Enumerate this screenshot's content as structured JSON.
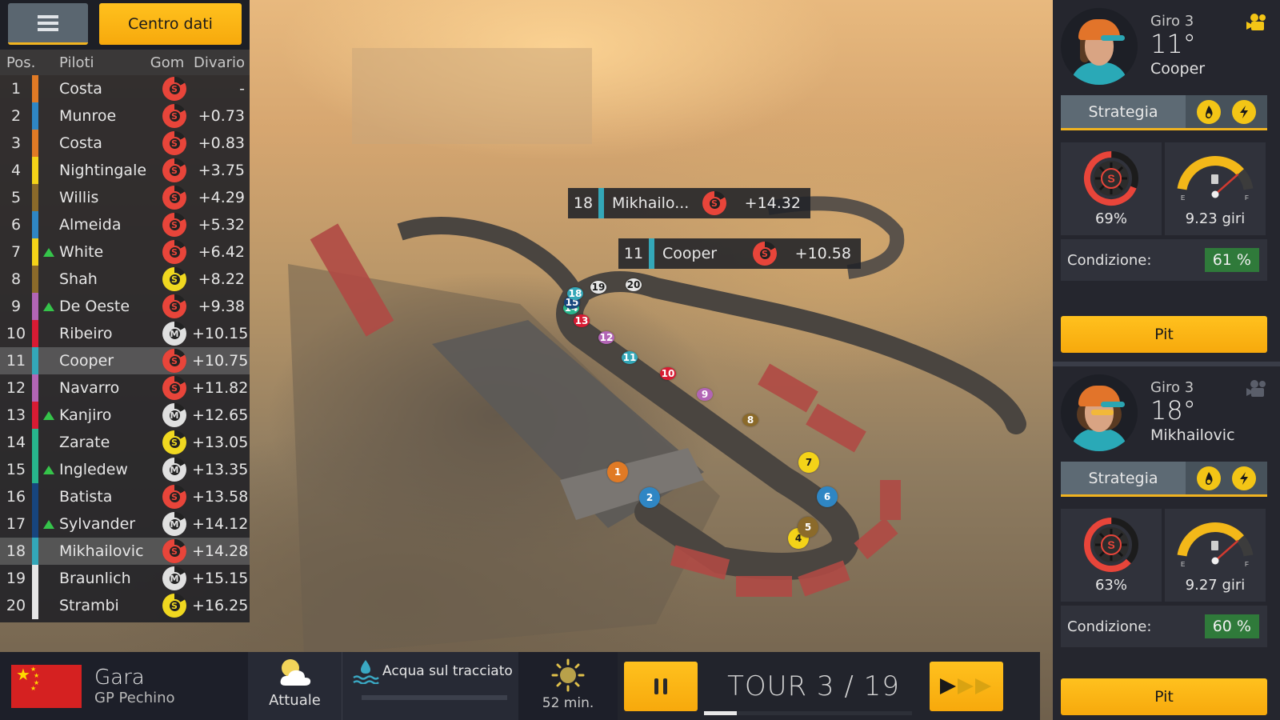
{
  "header": {
    "menu_icon": "hamburger-menu-icon",
    "data_center_label": "Centro dati"
  },
  "standings": {
    "columns": {
      "pos": "Pos.",
      "driver": "Piloti",
      "tyre": "Gom",
      "gap": "Divario"
    },
    "rows": [
      {
        "pos": "1",
        "name": "Costa",
        "team_color": "#e07a25",
        "tyre": "S",
        "tyre_color": "#e8453a",
        "gap": "-",
        "up": false,
        "highlight": false
      },
      {
        "pos": "2",
        "name": "Munroe",
        "team_color": "#2f86c4",
        "tyre": "S",
        "tyre_color": "#e8453a",
        "gap": "+0.73",
        "up": false,
        "highlight": false
      },
      {
        "pos": "3",
        "name": "Costa",
        "team_color": "#e07a25",
        "tyre": "S",
        "tyre_color": "#e8453a",
        "gap": "+0.83",
        "up": false,
        "highlight": false
      },
      {
        "pos": "4",
        "name": "Nightingale",
        "team_color": "#f4d318",
        "tyre": "S",
        "tyre_color": "#e8453a",
        "gap": "+3.75",
        "up": false,
        "highlight": false
      },
      {
        "pos": "5",
        "name": "Willis",
        "team_color": "#8b6a2a",
        "tyre": "S",
        "tyre_color": "#e8453a",
        "gap": "+4.29",
        "up": false,
        "highlight": false
      },
      {
        "pos": "6",
        "name": "Almeida",
        "team_color": "#2f86c4",
        "tyre": "S",
        "tyre_color": "#e8453a",
        "gap": "+5.32",
        "up": false,
        "highlight": false
      },
      {
        "pos": "7",
        "name": "White",
        "team_color": "#f4d318",
        "tyre": "S",
        "tyre_color": "#e8453a",
        "gap": "+6.42",
        "up": true,
        "highlight": false
      },
      {
        "pos": "8",
        "name": "Shah",
        "team_color": "#8b6a2a",
        "tyre": "S",
        "tyre_color": "#f0d820",
        "gap": "+8.22",
        "up": false,
        "highlight": false
      },
      {
        "pos": "9",
        "name": "De Oeste",
        "team_color": "#b265b5",
        "tyre": "S",
        "tyre_color": "#e8453a",
        "gap": "+9.38",
        "up": true,
        "highlight": false
      },
      {
        "pos": "10",
        "name": "Ribeiro",
        "team_color": "#d81b33",
        "tyre": "M",
        "tyre_color": "#e0e0e0",
        "gap": "+10.15",
        "up": false,
        "highlight": false
      },
      {
        "pos": "11",
        "name": "Cooper",
        "team_color": "#33a7b8",
        "tyre": "S",
        "tyre_color": "#e8453a",
        "gap": "+10.75",
        "up": false,
        "highlight": true
      },
      {
        "pos": "12",
        "name": "Navarro",
        "team_color": "#b265b5",
        "tyre": "S",
        "tyre_color": "#e8453a",
        "gap": "+11.82",
        "up": false,
        "highlight": false
      },
      {
        "pos": "13",
        "name": "Kanjiro",
        "team_color": "#d81b33",
        "tyre": "M",
        "tyre_color": "#e0e0e0",
        "gap": "+12.65",
        "up": true,
        "highlight": false
      },
      {
        "pos": "14",
        "name": "Zarate",
        "team_color": "#27b58c",
        "tyre": "S",
        "tyre_color": "#f0d820",
        "gap": "+13.05",
        "up": false,
        "highlight": false
      },
      {
        "pos": "15",
        "name": "Ingledew",
        "team_color": "#27b58c",
        "tyre": "M",
        "tyre_color": "#e0e0e0",
        "gap": "+13.35",
        "up": true,
        "highlight": false
      },
      {
        "pos": "16",
        "name": "Batista",
        "team_color": "#17457e",
        "tyre": "S",
        "tyre_color": "#e8453a",
        "gap": "+13.58",
        "up": false,
        "highlight": false
      },
      {
        "pos": "17",
        "name": "Sylvander",
        "team_color": "#17457e",
        "tyre": "M",
        "tyre_color": "#e0e0e0",
        "gap": "+14.12",
        "up": true,
        "highlight": false
      },
      {
        "pos": "18",
        "name": "Mikhailovic",
        "team_color": "#33a7b8",
        "tyre": "S",
        "tyre_color": "#e8453a",
        "gap": "+14.28",
        "up": false,
        "highlight": true
      },
      {
        "pos": "19",
        "name": "Braunlich",
        "team_color": "#e6e6e6",
        "tyre": "M",
        "tyre_color": "#e0e0e0",
        "gap": "+15.15",
        "up": false,
        "highlight": false
      },
      {
        "pos": "20",
        "name": "Strambi",
        "team_color": "#e6e6e6",
        "tyre": "S",
        "tyre_color": "#f0d820",
        "gap": "+16.25",
        "up": false,
        "highlight": false
      }
    ]
  },
  "map_labels": [
    {
      "pos": "18",
      "name": "Mikhailo...",
      "tyre": "S",
      "gap": "+14.32"
    },
    {
      "pos": "11",
      "name": "Cooper",
      "tyre": "S",
      "gap": "+10.58"
    }
  ],
  "car_markers": [
    {
      "num": "1",
      "color": "#e07a25"
    },
    {
      "num": "2",
      "color": "#2f86c4"
    },
    {
      "num": "4",
      "color": "#f4d318"
    },
    {
      "num": "5",
      "color": "#8b6a2a"
    },
    {
      "num": "6",
      "color": "#2f86c4"
    },
    {
      "num": "7",
      "color": "#f4d318"
    },
    {
      "num": "8",
      "color": "#8b6a2a"
    },
    {
      "num": "9",
      "color": "#b265b5"
    },
    {
      "num": "10",
      "color": "#d81b33"
    },
    {
      "num": "11",
      "color": "#33a7b8"
    },
    {
      "num": "12",
      "color": "#b265b5"
    },
    {
      "num": "13",
      "color": "#d81b33"
    },
    {
      "num": "14",
      "color": "#27b58c"
    },
    {
      "num": "15",
      "color": "#17457e"
    },
    {
      "num": "18",
      "color": "#33a7b8"
    },
    {
      "num": "19",
      "color": "#e6e6e6"
    },
    {
      "num": "20",
      "color": "#e6e6e6"
    }
  ],
  "drivers": [
    {
      "lap": "Giro 3",
      "position": "11°",
      "name": "Cooper",
      "camera_active": true,
      "strategy_label": "Strategia",
      "tyre_wear_pct": 69,
      "tyre_wear_label": "69%",
      "fuel_level_fraction": 0.8,
      "fuel_label": "9.23 giri",
      "fuel_e": "E",
      "fuel_f": "F",
      "condition_label": "Condizione:",
      "condition_value": "61 %",
      "pit_label": "Pit"
    },
    {
      "lap": "Giro 3",
      "position": "18°",
      "name": "Mikhailovic",
      "camera_active": false,
      "strategy_label": "Strategia",
      "tyre_wear_pct": 63,
      "tyre_wear_label": "63%",
      "fuel_level_fraction": 0.8,
      "fuel_label": "9.27 giri",
      "fuel_e": "E",
      "fuel_f": "F",
      "condition_label": "Condizione:",
      "condition_value": "60 %",
      "pit_label": "Pit"
    }
  ],
  "bottom": {
    "race_type": "Gara",
    "grand_prix": "GP Pechino",
    "weather_label": "Attuale",
    "water_label": "Acqua sul tracciato",
    "water_level_fraction": 0.0,
    "forecast_label": "52 min.",
    "lap_counter": "TOUR 3 / 19",
    "lap_progress_fraction": 0.158
  }
}
